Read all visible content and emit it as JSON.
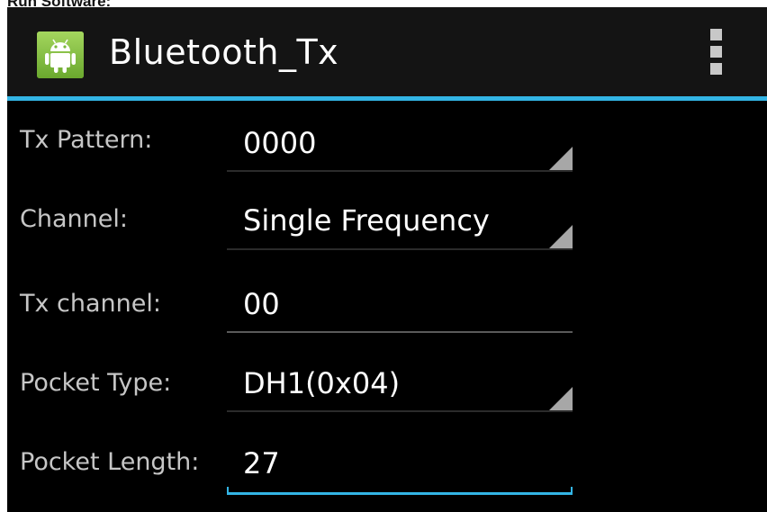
{
  "caption": "Run Software:",
  "app": {
    "title": "Bluetooth_Tx",
    "icon": "android-icon",
    "accent_color": "#33b5e5"
  },
  "rows": [
    {
      "label": "Tx Pattern:",
      "value": "0000",
      "kind": "spinner"
    },
    {
      "label": "Channel:",
      "value": "Single Frequency",
      "kind": "spinner"
    },
    {
      "label": "Tx channel:",
      "value": "00",
      "kind": "edit"
    },
    {
      "label": "Pocket Type:",
      "value": "DH1(0x04)",
      "kind": "spinner"
    },
    {
      "label": "Pocket Length:",
      "value": "27",
      "kind": "edit",
      "focused": true
    }
  ]
}
